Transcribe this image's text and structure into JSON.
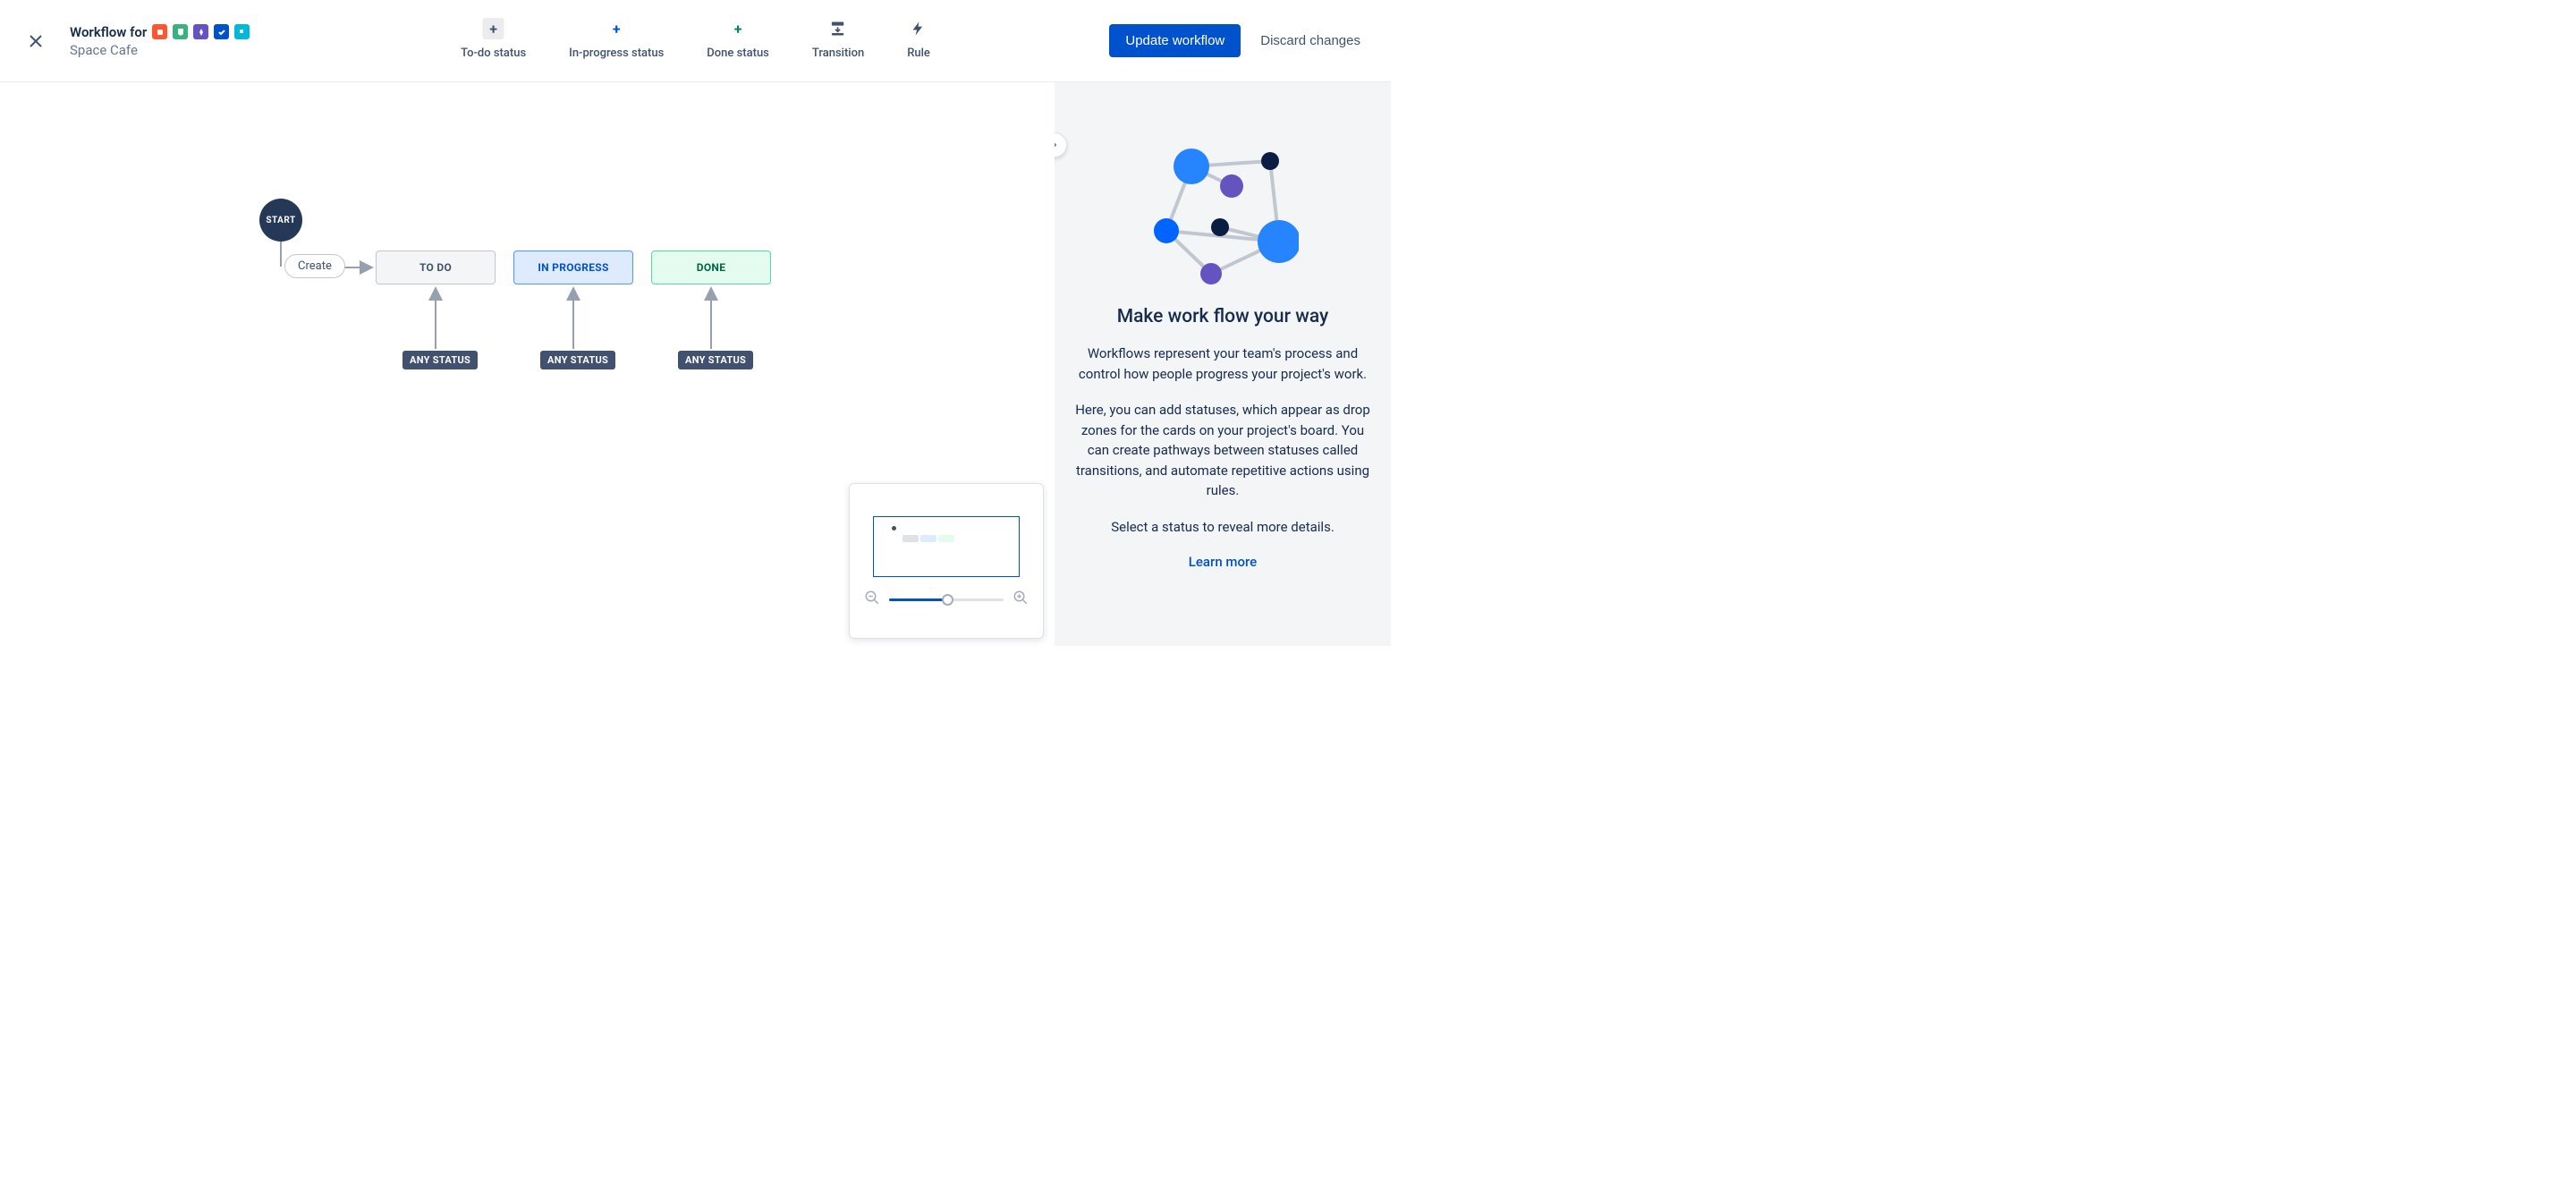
{
  "header": {
    "title": "Workflow for",
    "subtitle": "Space Cafe",
    "close_label": "Close"
  },
  "toolbar": {
    "todo": "To-do status",
    "in_progress": "In-progress status",
    "done": "Done status",
    "transition": "Transition",
    "rule": "Rule"
  },
  "actions": {
    "update": "Update workflow",
    "discard": "Discard changes"
  },
  "canvas": {
    "start": "START",
    "create": "Create",
    "status_todo": "TO DO",
    "status_progress": "IN PROGRESS",
    "status_done": "DONE",
    "any_status": "ANY STATUS"
  },
  "side_panel": {
    "title": "Make work flow your way",
    "p1": "Workflows represent your team's process and control how people progress your project's work.",
    "p2": "Here, you can add statuses, which appear as drop zones for the cards on your project's board. You can create pathways between statuses called transitions, and automate repetitive actions using rules.",
    "p3": "Select a status to reveal more details.",
    "learn_more": "Learn more"
  }
}
